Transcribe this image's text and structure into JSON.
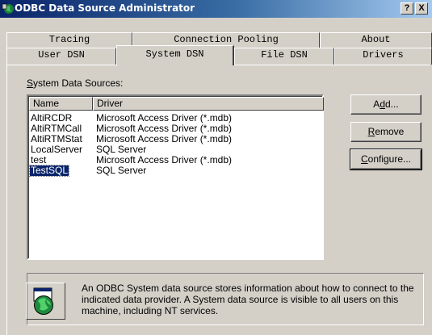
{
  "window": {
    "title": "ODBC Data Source Administrator",
    "help_label": "?",
    "close_label": "X"
  },
  "tabs_row1": [
    {
      "label": "Tracing"
    },
    {
      "label": "Connection Pooling"
    },
    {
      "label": "About"
    }
  ],
  "tabs_row2": [
    {
      "label": "User DSN"
    },
    {
      "label": "System DSN",
      "selected": true
    },
    {
      "label": "File DSN"
    },
    {
      "label": "Drivers"
    }
  ],
  "system_sources": {
    "label_rest": "ystem Data Sources:",
    "label_mnemonic": "S",
    "columns": [
      "Name",
      "Driver"
    ],
    "rows": [
      {
        "name": "AltiRCDR",
        "driver": "Microsoft Access Driver (*.mdb)"
      },
      {
        "name": "AltiRTMCall",
        "driver": "Microsoft Access Driver (*.mdb)"
      },
      {
        "name": "AltiRTMStat",
        "driver": "Microsoft Access Driver (*.mdb)"
      },
      {
        "name": "LocalServer",
        "driver": "SQL Server"
      },
      {
        "name": "test",
        "driver": "Microsoft Access Driver (*.mdb)"
      },
      {
        "name": "TestSQL",
        "driver": "SQL Server",
        "selected": true
      }
    ]
  },
  "buttons": {
    "add": {
      "pre": "A",
      "mnemonic": "d",
      "post": "d..."
    },
    "remove": {
      "pre": "",
      "mnemonic": "R",
      "post": "emove"
    },
    "configure": {
      "pre": "",
      "mnemonic": "C",
      "post": "onfigure..."
    }
  },
  "info": {
    "text": "An ODBC System data source stores information about how to connect to the indicated data provider.  A System data source is visible to all users on this machine, including NT services.",
    "icon": "database-globe-icon"
  }
}
